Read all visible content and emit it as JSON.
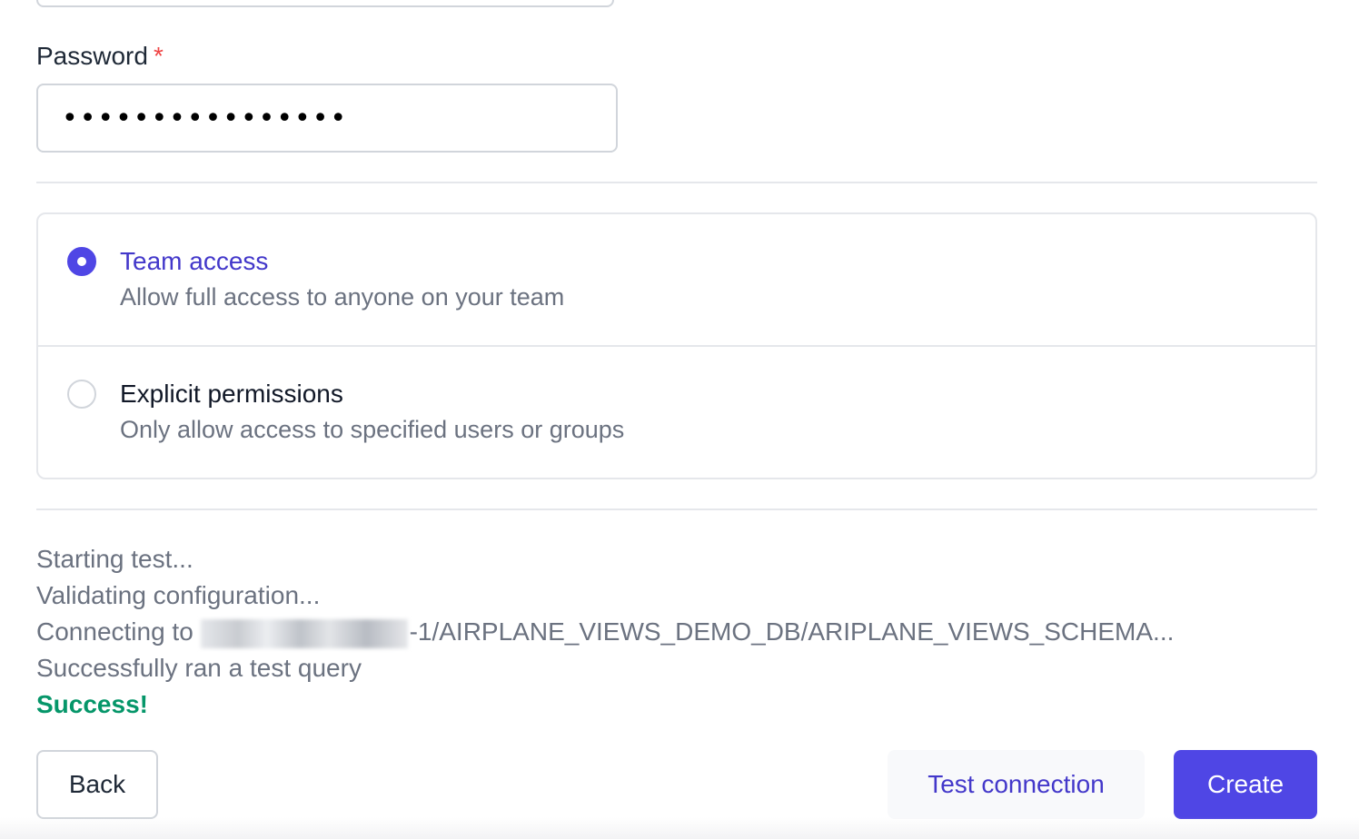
{
  "form": {
    "password_label": "Password",
    "required_marker": "*",
    "password_value": "••••••••••••••••"
  },
  "access": {
    "options": [
      {
        "title": "Team access",
        "description": "Allow full access to anyone on your team",
        "selected": true
      },
      {
        "title": "Explicit permissions",
        "description": "Only allow access to specified users or groups",
        "selected": false
      }
    ]
  },
  "test_log": {
    "line1": "Starting test...",
    "line2": "Validating configuration...",
    "line3_prefix": "Connecting to ",
    "line3_suffix": "-1/AIRPLANE_VIEWS_DEMO_DB/ARIPLANE_VIEWS_SCHEMA...",
    "line4": "Successfully ran a test query",
    "result": "Success!"
  },
  "actions": {
    "back_label": "Back",
    "test_label": "Test connection",
    "create_label": "Create"
  },
  "colors": {
    "accent": "#4f46e5",
    "success": "#059669",
    "required": "#ef4444"
  }
}
